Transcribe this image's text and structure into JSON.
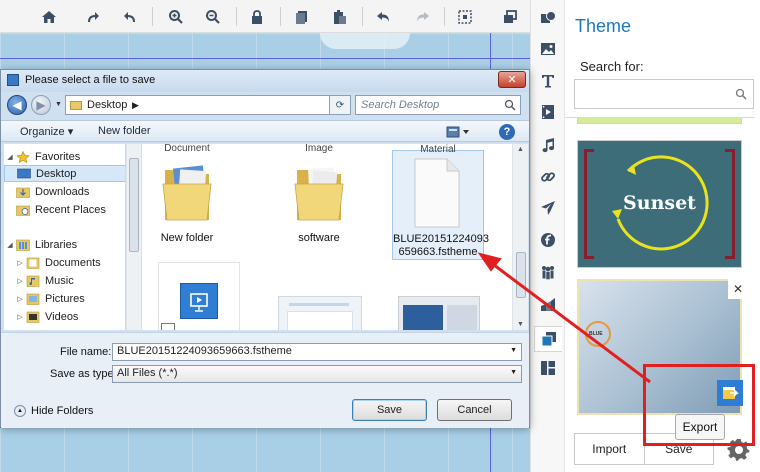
{
  "colors": {
    "accent": "#1e78b8",
    "highlight": "#e02020",
    "canvas": "#a9cfe6",
    "export_icon": "#2e7dd2"
  },
  "toolbar": {
    "icons": [
      "home-icon",
      "redo-curve-icon",
      "undo-curve-icon",
      "zoom-in-icon",
      "zoom-out-icon",
      "lock-icon",
      "copy-icon",
      "paste-icon",
      "undo-icon",
      "redo-icon",
      "select-area-icon",
      "group-icon"
    ]
  },
  "dialog": {
    "title": "Please select a file to save",
    "close_label": "✕",
    "address": "Desktop",
    "search_placeholder": "Search Desktop",
    "organize_label": "Organize ▾",
    "new_folder_label": "New folder",
    "help_label": "?",
    "nav": {
      "favorites": "Favorites",
      "desktop": "Desktop",
      "downloads": "Downloads",
      "recent_places": "Recent Places",
      "libraries": "Libraries",
      "documents": "Documents",
      "music": "Music",
      "pictures": "Pictures",
      "videos": "Videos"
    },
    "files": {
      "cut_labels": [
        "Document",
        "Image",
        "Material"
      ],
      "new_folder": "New folder",
      "software": "software",
      "theme_file_line1": "BLUE20151224093",
      "theme_file_line2": "659663.fstheme"
    },
    "file_name_label": "File name:",
    "file_name_value": "BLUE20151224093659663.fstheme",
    "save_type_label": "Save as type:",
    "save_type_value": "All Files (*.*)",
    "hide_folders_label": "Hide Folders",
    "save_button": "Save",
    "cancel_button": "Cancel"
  },
  "sidebar": {
    "icons": [
      "shape-icon",
      "image-icon",
      "text-icon",
      "video-icon",
      "music-icon",
      "link-icon",
      "plane-icon",
      "flash-icon",
      "people-icon",
      "chart-icon",
      "theme-icon",
      "layout-icon"
    ]
  },
  "theme_panel": {
    "title": "Theme",
    "search_label": "Search for:",
    "search_value": "",
    "themes": [
      {
        "name": "Sunset"
      },
      {
        "name": "BLUE"
      }
    ],
    "close_label": "✕",
    "tooltip": "Export",
    "import_label": "Import",
    "save_label": "Save"
  }
}
